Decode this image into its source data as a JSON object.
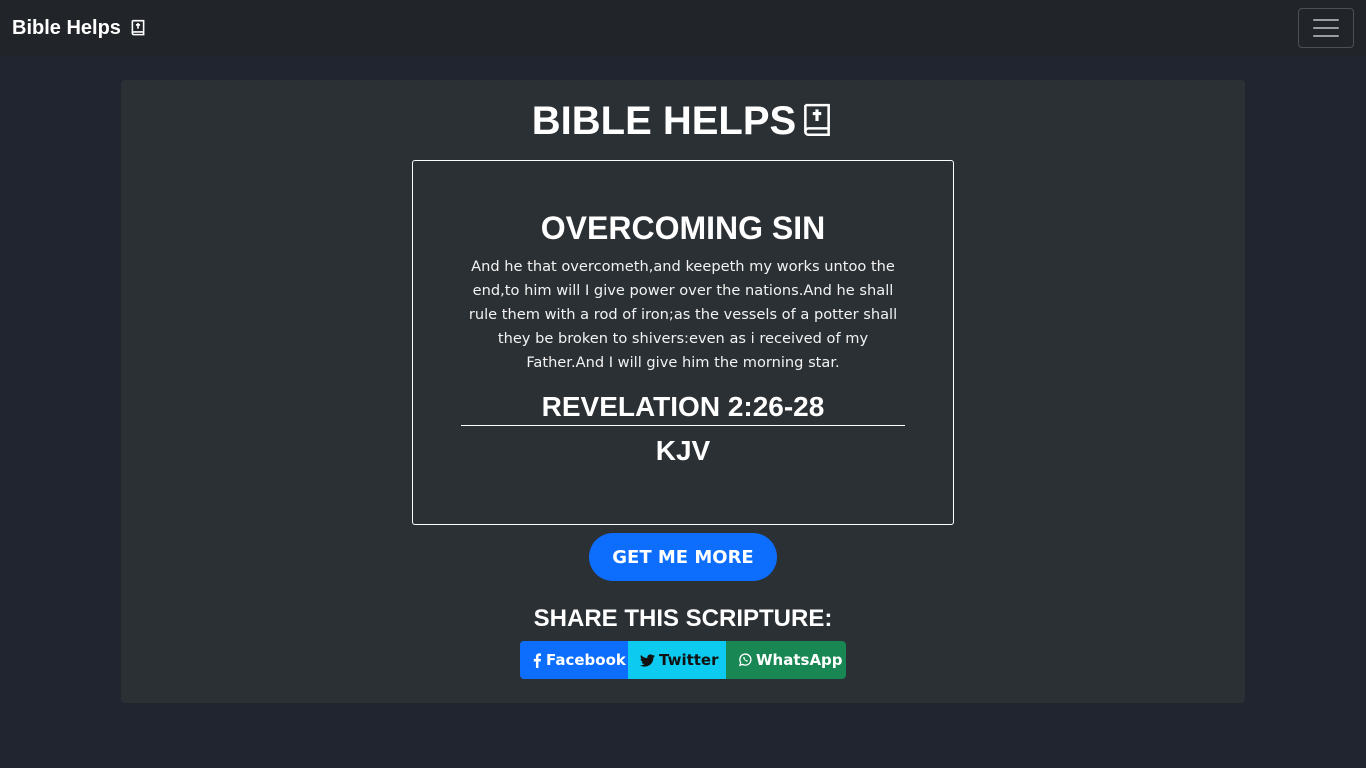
{
  "navbar": {
    "brand": "Bible Helps",
    "toggle_icon": "hamburger-menu-icon"
  },
  "main": {
    "title": "BIBLE HELPS",
    "title_icon": "bible-book-icon",
    "card": {
      "topic": "OVERCOMING SIN",
      "verse": "And he that overcometh,and keepeth my works untoo the end,to him will I give power over the nations.And he shall rule them with a rod of iron;as the vessels of a potter shall they be broken to shivers:even as i received of my Father.And I will give him the morning star.",
      "reference": "REVELATION 2:26-28",
      "version": "KJV"
    },
    "more_button": "GET ME MORE",
    "share": {
      "title": "SHARE THIS SCRIPTURE:",
      "buttons": [
        {
          "label": "Facebook",
          "icon": "facebook-icon",
          "color": "#0d6efd"
        },
        {
          "label": "Twitter",
          "icon": "twitter-icon",
          "color": "#0dcaf0"
        },
        {
          "label": "WhatsApp",
          "icon": "whatsapp-icon",
          "color": "#198754"
        }
      ]
    }
  },
  "colors": {
    "page_background": "#212530",
    "navbar_background": "#212529",
    "panel_background": "#2b3035",
    "accent": "#0d6efd"
  }
}
